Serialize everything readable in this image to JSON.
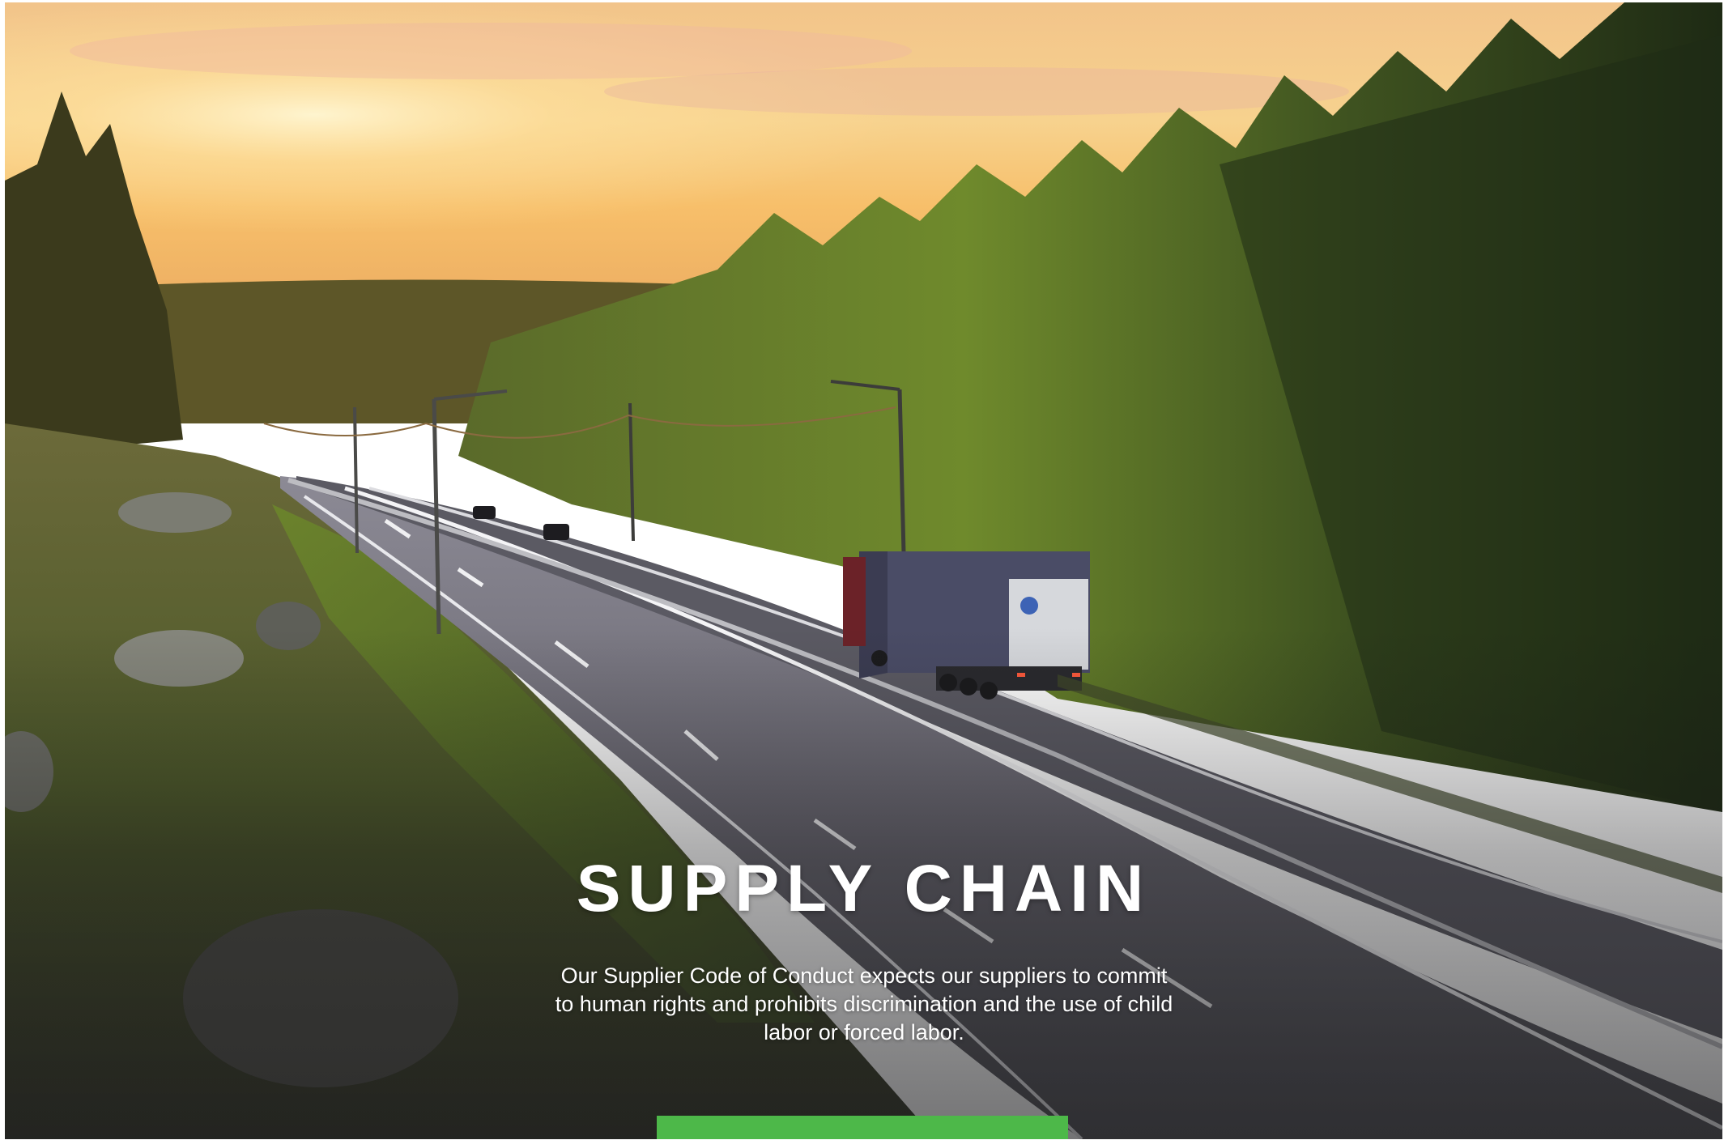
{
  "hero": {
    "title": "SUPPLY CHAIN",
    "description": "Our Supplier Code of Conduct expects our suppliers to commit to human rights and prohibits discrimination and the use of child labor or forced labor.",
    "cta_color": "#4db849"
  },
  "colors": {
    "accent_green": "#4db849",
    "text": "#ffffff"
  }
}
